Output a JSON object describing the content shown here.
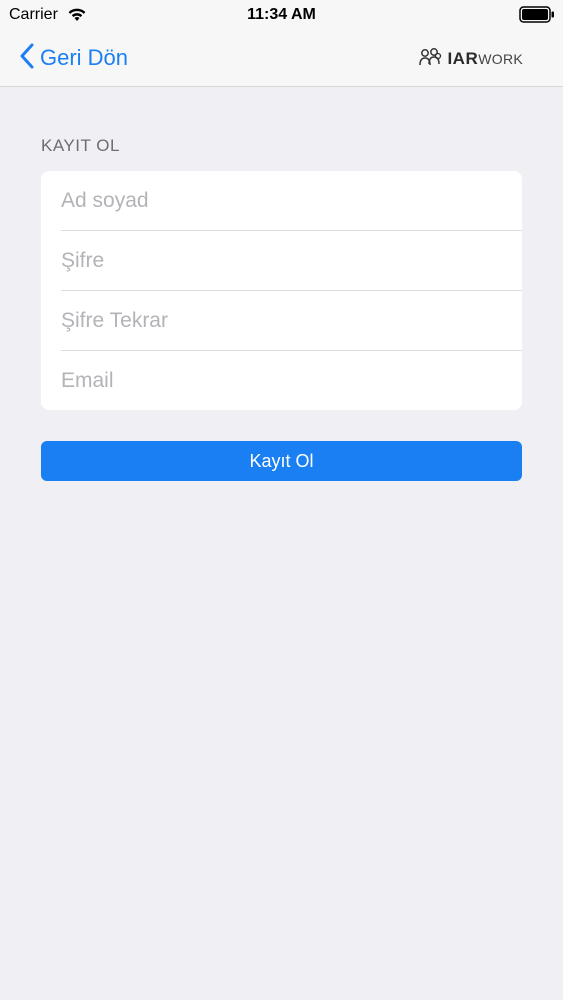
{
  "status_bar": {
    "carrier": "Carrier",
    "time": "11:34 AM",
    "icons": [
      "wifi-icon",
      "battery-icon"
    ]
  },
  "nav": {
    "back_label": "Geri Dön",
    "back_icon": "chevron-left-icon",
    "logo": {
      "brand": "IAR",
      "suffix": "WORK",
      "icon": "people-logo-icon"
    }
  },
  "form": {
    "section_title": "KAYIT OL",
    "fields": [
      {
        "placeholder": "Ad soyad",
        "value": ""
      },
      {
        "placeholder": "Şifre",
        "value": ""
      },
      {
        "placeholder": "Şifre Tekrar",
        "value": ""
      },
      {
        "placeholder": "Email",
        "value": ""
      }
    ],
    "submit_label": "Kayıt Ol"
  },
  "colors": {
    "accent": "#1a7ff2",
    "background": "#efeff4",
    "card": "#ffffff",
    "placeholder": "#b3b3b8",
    "section_header": "#6d6d72"
  }
}
